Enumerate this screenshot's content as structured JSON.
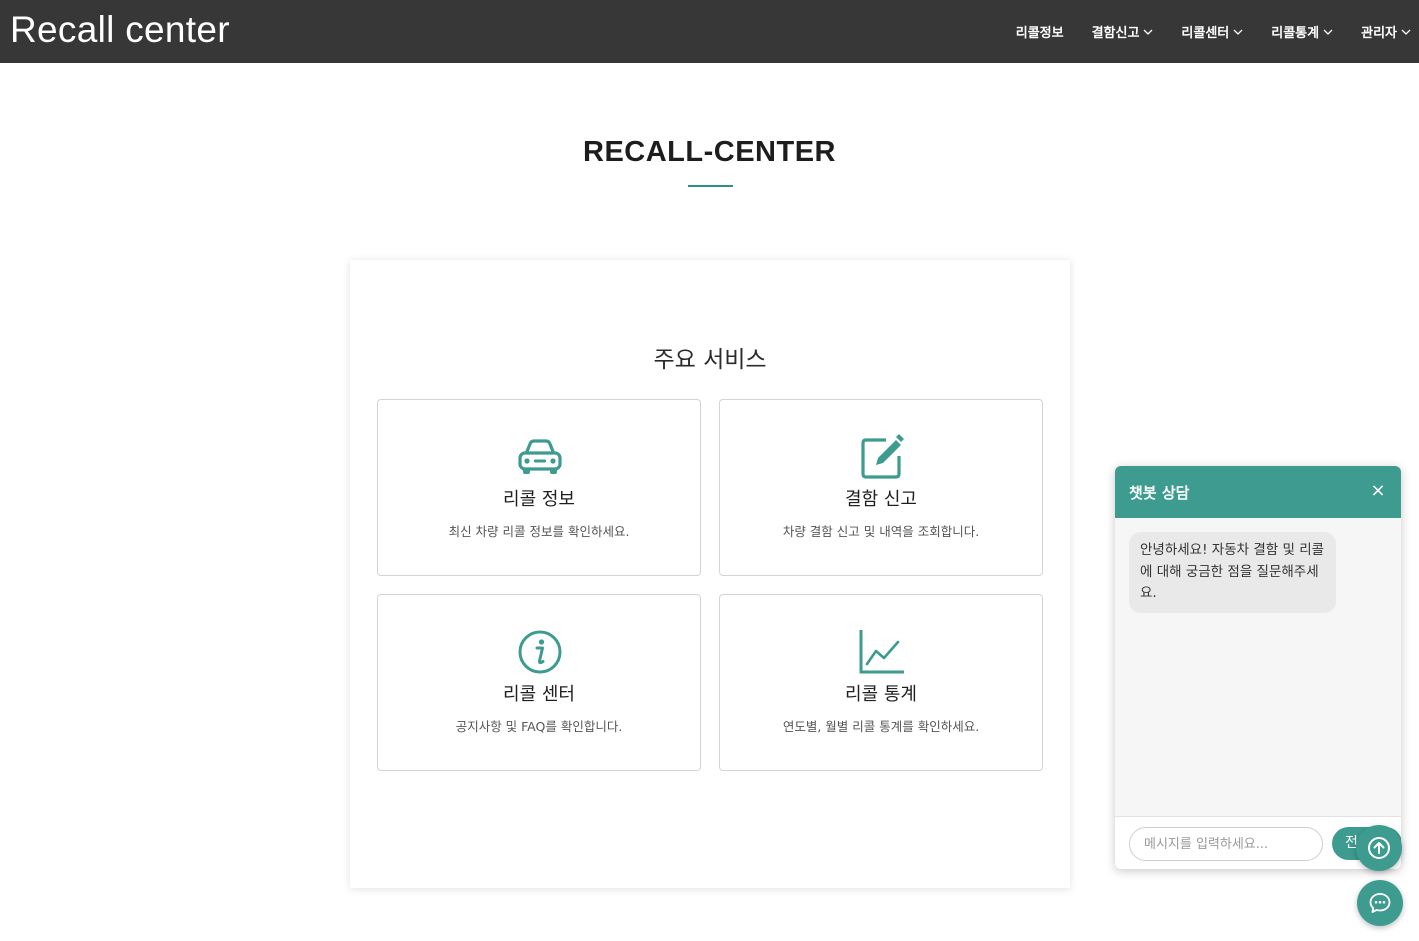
{
  "header": {
    "brand": "Recall center",
    "nav": [
      {
        "label": "리콜정보",
        "dropdown": false
      },
      {
        "label": "결함신고",
        "dropdown": true
      },
      {
        "label": "리콜센터",
        "dropdown": true
      },
      {
        "label": "리콜통계",
        "dropdown": true
      },
      {
        "label": "관리자",
        "dropdown": true
      }
    ]
  },
  "main": {
    "title": "RECALL-CENTER",
    "services_heading": "주요 서비스",
    "services": [
      {
        "icon": "car-icon",
        "title": "리콜 정보",
        "desc": "최신 차량 리콜 정보를 확인하세요."
      },
      {
        "icon": "edit-icon",
        "title": "결함 신고",
        "desc": "차량 결함 신고 및 내역을 조회합니다."
      },
      {
        "icon": "info-icon",
        "title": "리콜 센터",
        "desc": "공지사항 및 FAQ를 확인합니다."
      },
      {
        "icon": "line-chart-icon",
        "title": "리콜 통계",
        "desc": "연도별, 월별 리콜 통계를 확인하세요."
      }
    ]
  },
  "chat": {
    "title": "챗봇 상담",
    "close_icon": "close-icon",
    "message": "안녕하세요! 자동차 결함 및 리콜에 대해 궁금한 점을 질문해주세요.",
    "input_placeholder": "메시지를 입력하세요...",
    "send_label": "전송"
  },
  "colors": {
    "accent": "#3e9b8f",
    "header_bg": "#373737"
  }
}
